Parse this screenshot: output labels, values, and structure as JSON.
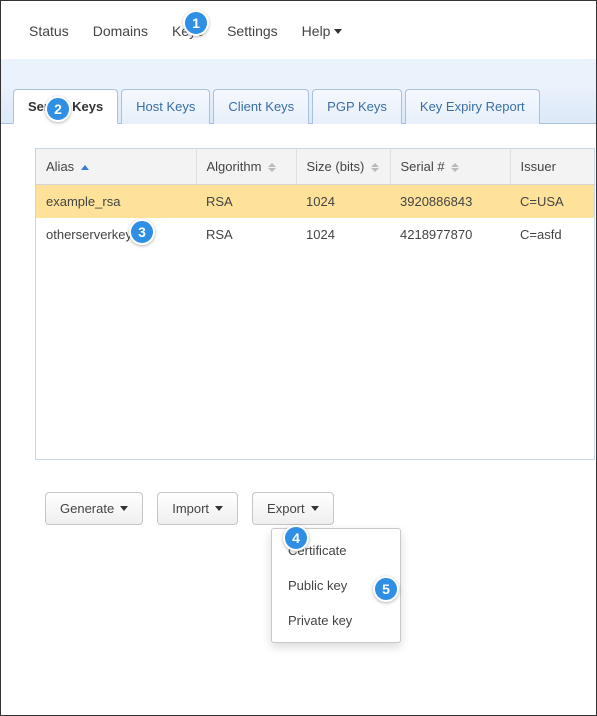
{
  "menu": {
    "status": "Status",
    "domains": "Domains",
    "keys": "Keys",
    "settings": "Settings",
    "help": "Help"
  },
  "tabs": {
    "server_keys": "Server Keys",
    "host_keys": "Host Keys",
    "client_keys": "Client Keys",
    "pgp_keys": "PGP Keys",
    "key_expiry": "Key Expiry Report"
  },
  "table": {
    "headers": {
      "alias": "Alias",
      "algorithm": "Algorithm",
      "size": "Size (bits)",
      "serial": "Serial #",
      "issuer": "Issuer"
    },
    "rows": [
      {
        "alias": "example_rsa",
        "algorithm": "RSA",
        "size": "1024",
        "serial": "3920886843",
        "issuer": "C=USA"
      },
      {
        "alias": "otherserverkey",
        "algorithm": "RSA",
        "size": "1024",
        "serial": "4218977870",
        "issuer": "C=asfd"
      }
    ]
  },
  "buttons": {
    "generate": "Generate",
    "import": "Import",
    "export": "Export"
  },
  "export_menu": {
    "certificate": "Certificate",
    "public_key": "Public key",
    "private_key": "Private key"
  },
  "markers": {
    "m1": "1",
    "m2": "2",
    "m3": "3",
    "m4": "4",
    "m5": "5"
  }
}
